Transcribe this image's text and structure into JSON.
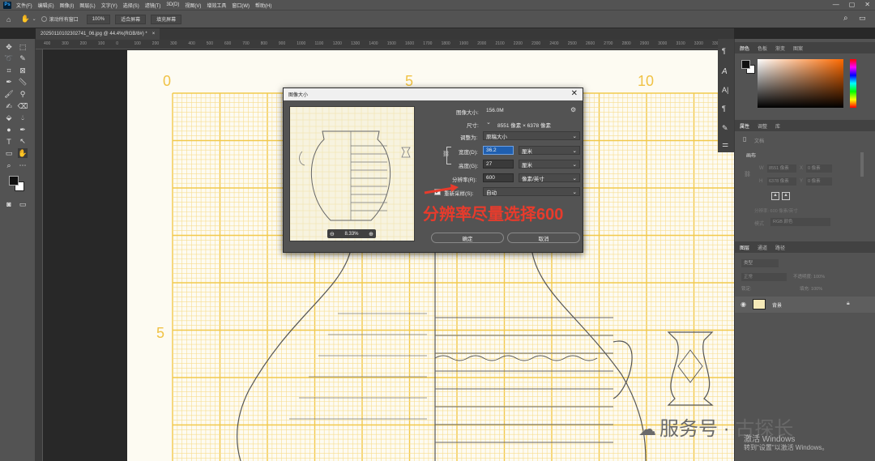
{
  "menubar": {
    "logo": "Ps",
    "items": [
      "文件(F)",
      "编辑(E)",
      "图像(I)",
      "图层(L)",
      "文字(Y)",
      "选择(S)",
      "滤镜(T)",
      "3D(D)",
      "视图(V)",
      "增效工具",
      "窗口(W)",
      "帮助(H)"
    ],
    "win_min": "—",
    "win_max": "▢",
    "win_close": "✕"
  },
  "optbar": {
    "scroll_all": "滚动所有窗口",
    "zoom": "100%",
    "fit_screen": "适合屏幕",
    "fill_screen": "填充屏幕"
  },
  "tab": {
    "label": "20250110102302741_06.jpg @ 44.4%(RGB/8#) *",
    "close": "×"
  },
  "ruler": [
    "400",
    "300",
    "200",
    "100",
    "0",
    "100",
    "200",
    "300",
    "400",
    "500",
    "600",
    "700",
    "800",
    "900",
    "1000",
    "1100",
    "1200",
    "1300",
    "1400",
    "1500",
    "1600",
    "1700",
    "1800",
    "1900",
    "2000",
    "2100",
    "2200",
    "2300",
    "2400",
    "2500",
    "2600",
    "2700",
    "2800",
    "2900",
    "3000",
    "3100",
    "3200",
    "3300"
  ],
  "graph_labels": {
    "top_0": "0",
    "top_5": "5",
    "top_10": "10",
    "left_5": "5"
  },
  "right_panel": {
    "tabs1": [
      "颜色",
      "色板",
      "渐变",
      "图案"
    ],
    "tabs2": [
      "属性",
      "调整",
      "库"
    ],
    "doc_label": "文档",
    "canvas_label": "画布",
    "w_label": "W",
    "w_val": "8551 像素",
    "x_label": "X",
    "x_val": "0 像素",
    "h_label": "H",
    "h_val": "6378 像素",
    "y_label": "Y",
    "y_val": "0 像素",
    "res_label": "分辨率: 600 像素/英寸",
    "mode_label": "模式",
    "mode_val": "RGB 颜色",
    "tabs3": [
      "图层",
      "通道",
      "路径"
    ],
    "kind": "类型",
    "normal": "正常",
    "opacity": "不透明度: 100%",
    "lock": "锁定:",
    "fill": "填充: 100%",
    "layer_name": "背景"
  },
  "dialog": {
    "title": "图像大小",
    "close": "✕",
    "image_size_label": "图像大小:",
    "image_size_val": "156.0M",
    "dimensions_label": "尺寸:",
    "dimensions_val": "8551 像素 × 6378 像素",
    "fit_label": "调整为:",
    "fit_val": "原稿大小",
    "width_label": "宽度(D):",
    "width_val": "36.2",
    "width_unit": "厘米",
    "height_label": "高度(G):",
    "height_val": "27",
    "height_unit": "厘米",
    "resolution_label": "分辨率(R):",
    "resolution_val": "600",
    "resolution_unit": "像素/英寸",
    "resample_label": "重新采样(S):",
    "resample_val": "自动",
    "preview_zoom": "8.33%",
    "ok": "确定",
    "cancel": "取消"
  },
  "annotation": "分辨率尽量选择600",
  "watermark": "服务号 · 古探长",
  "activate": {
    "line1": "激活 Windows",
    "line2": "转到\"设置\"以激活 Windows。"
  },
  "colors": {
    "grid": "#f2c94c",
    "grid_minor": "#f7dd8e",
    "annotation": "#e83b2c",
    "dialog_bg": "#535353"
  }
}
